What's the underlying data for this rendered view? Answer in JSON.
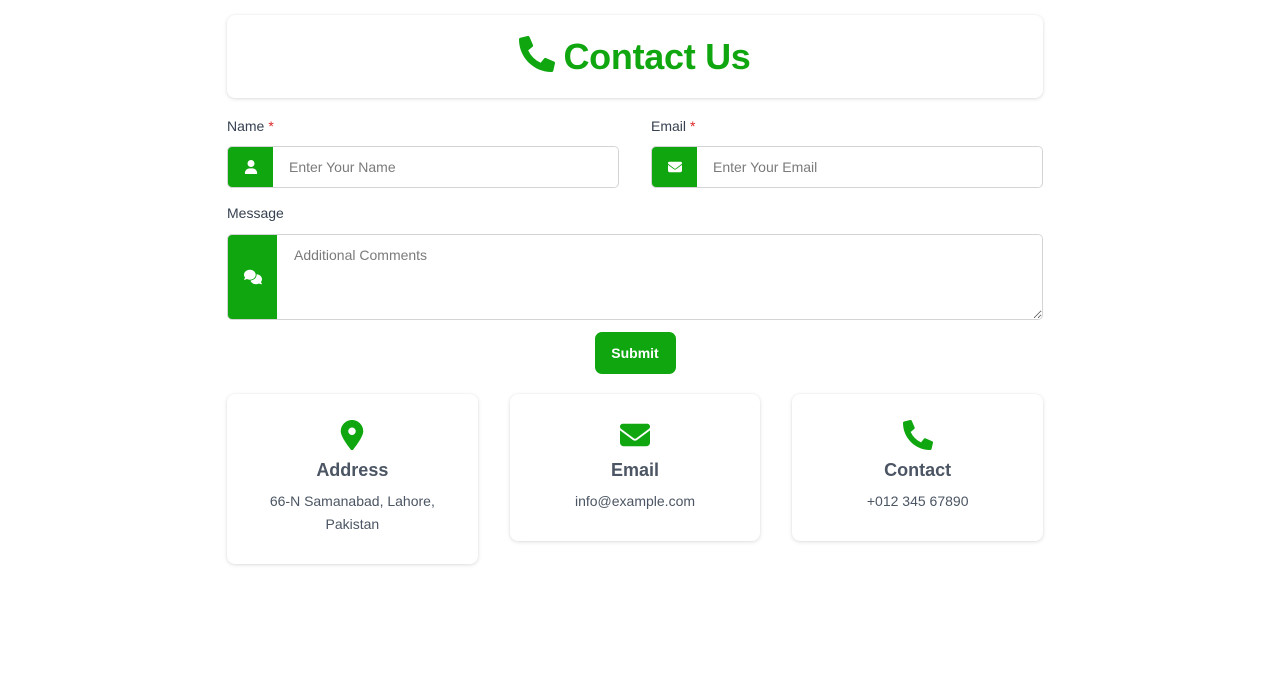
{
  "header": {
    "title": "Contact Us",
    "icon": "phone-icon"
  },
  "form": {
    "name": {
      "label": "Name",
      "required_mark": "*",
      "placeholder": "Enter Your Name",
      "value": "",
      "icon": "user-icon"
    },
    "email": {
      "label": "Email",
      "required_mark": "*",
      "placeholder": "Enter Your Email",
      "value": "",
      "icon": "envelope-icon"
    },
    "message": {
      "label": "Message",
      "placeholder": "Additional Comments",
      "value": "",
      "icon": "comments-icon"
    },
    "submit_label": "Submit"
  },
  "info_cards": [
    {
      "icon": "map-pin-icon",
      "title": "Address",
      "text": "66-N Samanabad, Lahore, Pakistan"
    },
    {
      "icon": "envelope-icon",
      "title": "Email",
      "text": "info@example.com"
    },
    {
      "icon": "phone-icon",
      "title": "Contact",
      "text": "+012 345 67890"
    }
  ],
  "colors": {
    "accent": "#0fa60f",
    "required": "#dc2626",
    "text": "#374151",
    "border": "#d4d4d4"
  }
}
